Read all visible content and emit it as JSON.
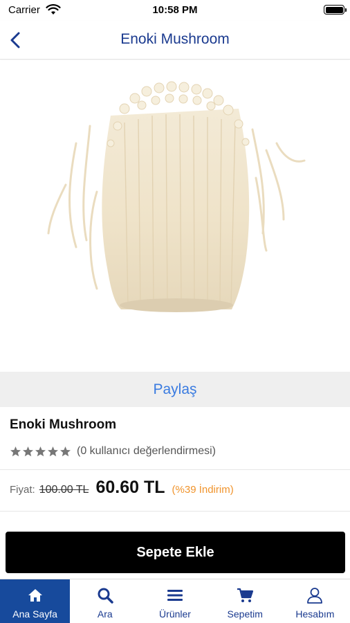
{
  "status_bar": {
    "carrier": "Carrier",
    "time": "10:58 PM"
  },
  "nav": {
    "title": "Enoki Mushroom",
    "back_icon": "chevron-left-icon"
  },
  "product": {
    "image": "enoki-mushroom-photo",
    "name": "Enoki Mushroom",
    "rating": 0,
    "rating_text": "(0 kullanıcı değerlendirmesi)",
    "price_label": "Fiyat:",
    "old_price": "100.00 TL",
    "new_price": "60.60 TL",
    "discount": "(%39  İndirim)"
  },
  "share_label": "Paylaş",
  "add_to_cart_label": "Sepete Ekle",
  "tabs": [
    {
      "label": "Ana Sayfa",
      "icon": "home-icon",
      "active": true
    },
    {
      "label": "Ara",
      "icon": "search-icon",
      "active": false
    },
    {
      "label": "Ürünler",
      "icon": "menu-icon",
      "active": false
    },
    {
      "label": "Sepetim",
      "icon": "cart-icon",
      "active": false
    },
    {
      "label": "Hesabım",
      "icon": "user-icon",
      "active": false
    }
  ],
  "colors": {
    "accent": "#1a3a8f",
    "active_tab": "#174a9c",
    "share_link": "#3a7be0",
    "discount": "#f0932b",
    "star": "#777777"
  }
}
